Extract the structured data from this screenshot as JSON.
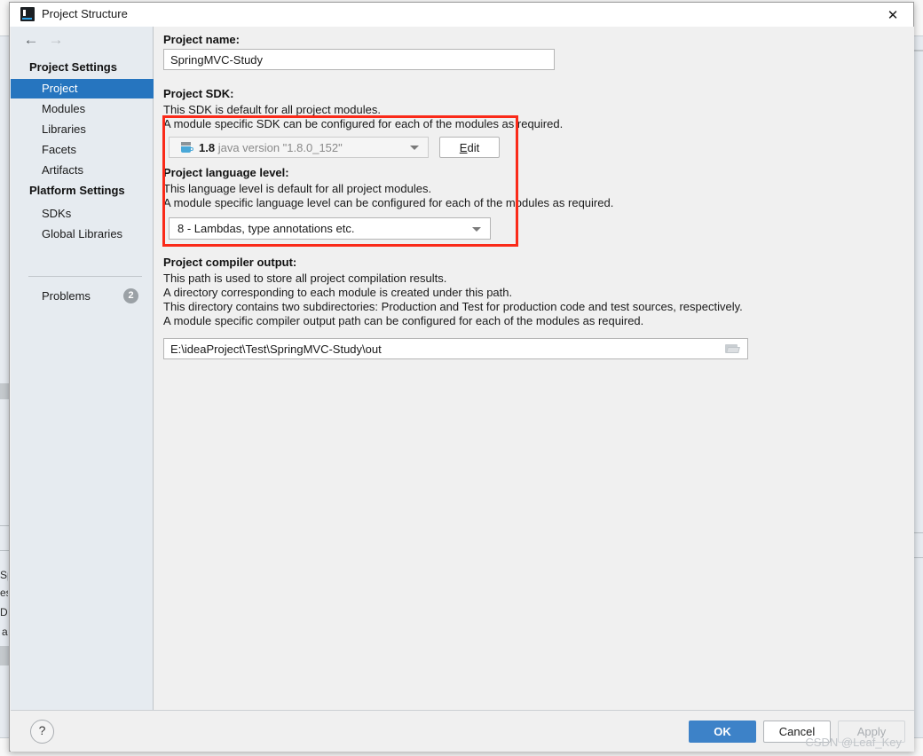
{
  "window": {
    "title": "Project Structure",
    "app_icon": "intellij-idea-icon",
    "close_label": "✕",
    "nav_back": "←",
    "nav_forward": "→"
  },
  "sidebar": {
    "groups": [
      {
        "label": "Project Settings"
      },
      {
        "label": "Platform Settings"
      }
    ],
    "project_settings_items": [
      {
        "label": "Project",
        "selected": true
      },
      {
        "label": "Modules",
        "selected": false
      },
      {
        "label": "Libraries",
        "selected": false
      },
      {
        "label": "Facets",
        "selected": false
      },
      {
        "label": "Artifacts",
        "selected": false
      }
    ],
    "platform_settings_items": [
      {
        "label": "SDKs",
        "selected": false
      },
      {
        "label": "Global Libraries",
        "selected": false
      }
    ],
    "problems": {
      "label": "Problems",
      "count": "2"
    }
  },
  "main": {
    "project_name": {
      "label": "Project name:",
      "value": "SpringMVC-Study",
      "placeholder": ""
    },
    "project_sdk": {
      "label": "Project SDK:",
      "desc_line_1": "This SDK is default for all project modules.",
      "desc_line_2": "A module specific SDK can be configured for each of the modules as required.",
      "selected_version": "1.8",
      "selected_detail": "java version \"1.8.0_152\"",
      "icon": "java-sdk-icon",
      "edit_button": {
        "mnemonic": "E",
        "rest": "dit"
      }
    },
    "language_level": {
      "label": "Project language level:",
      "desc_line_1": "This language level is default for all project modules.",
      "desc_line_2": "A module specific language level can be configured for each of the modules as required.",
      "selected": "8 - Lambdas, type annotations etc."
    },
    "compiler_output": {
      "label": "Project compiler output:",
      "desc_line_1": "This path is used to store all project compilation results.",
      "desc_line_2": "A directory corresponding to each module is created under this path.",
      "desc_line_3": "This directory contains two subdirectories: Production and Test for production code and test sources, respectively.",
      "desc_line_4": "A module specific compiler output path can be configured for each of the modules as required.",
      "value": "E:\\ideaProject\\Test\\SpringMVC-Study\\out",
      "browse_icon": "folder-browse-icon"
    }
  },
  "annotation": {
    "highlight_color": "#fa2a19"
  },
  "footer": {
    "help_label": "?",
    "ok_label": "OK",
    "cancel_label": "Cancel",
    "apply_label": "Apply",
    "watermark": "CSDN @Leaf_Key"
  },
  "background": {
    "fragments": [
      "Sp",
      "es",
      "D",
      "a"
    ]
  },
  "colors": {
    "accent_blue": "#2675bf",
    "ok_button": "#3d82c8",
    "annotation_red": "#fa2a19",
    "sidebar_bg": "#e6ebf0",
    "content_bg": "#f0f0f0"
  }
}
